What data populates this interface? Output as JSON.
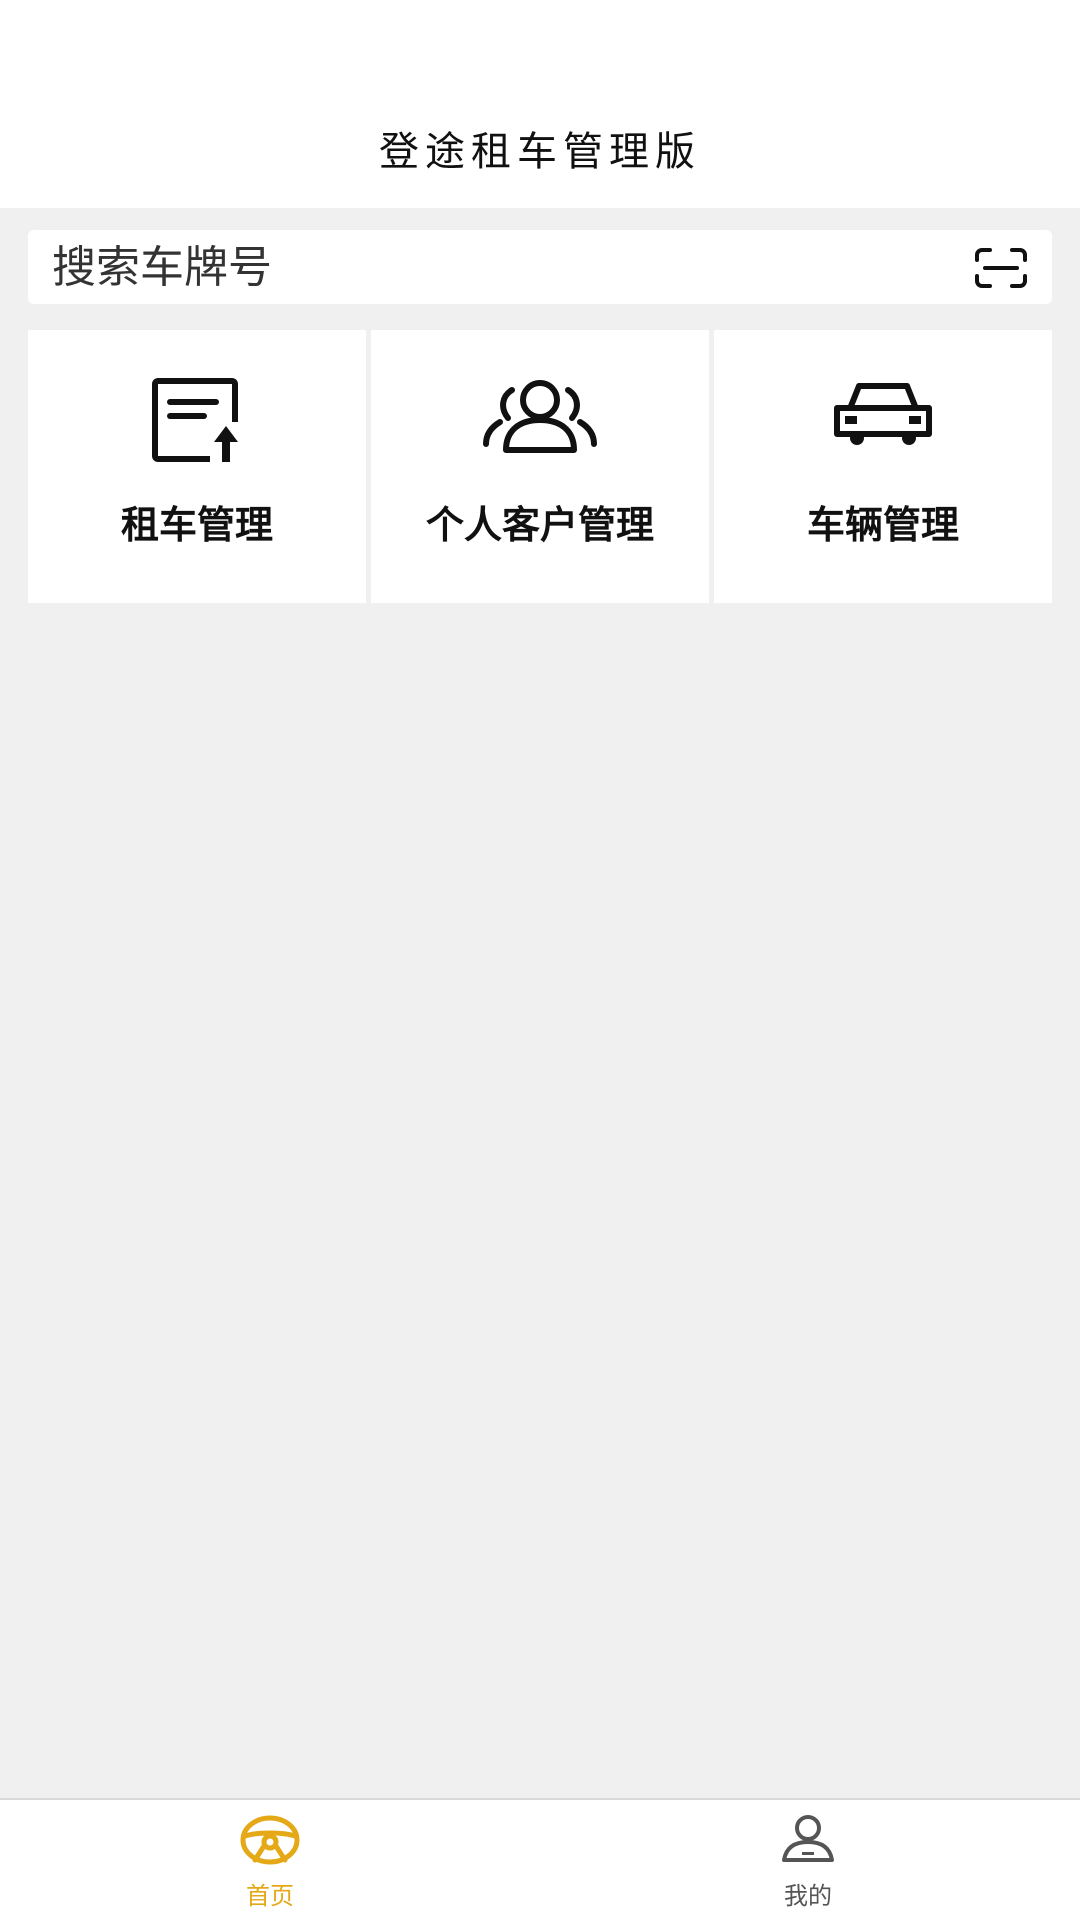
{
  "header": {
    "title": "登途租车管理版"
  },
  "search": {
    "placeholder": "搜索车牌号",
    "icon": "scan-icon"
  },
  "menu": [
    {
      "label": "租车管理",
      "icon": "rental-document-icon"
    },
    {
      "label": "个人客户管理",
      "icon": "customers-icon"
    },
    {
      "label": "车辆管理",
      "icon": "car-icon"
    }
  ],
  "tabbar": {
    "items": [
      {
        "label": "首页",
        "icon": "steering-wheel-icon",
        "active": true
      },
      {
        "label": "我的",
        "icon": "user-icon",
        "active": false
      }
    ],
    "active_color": "#e5a817",
    "inactive_color": "#555555"
  }
}
